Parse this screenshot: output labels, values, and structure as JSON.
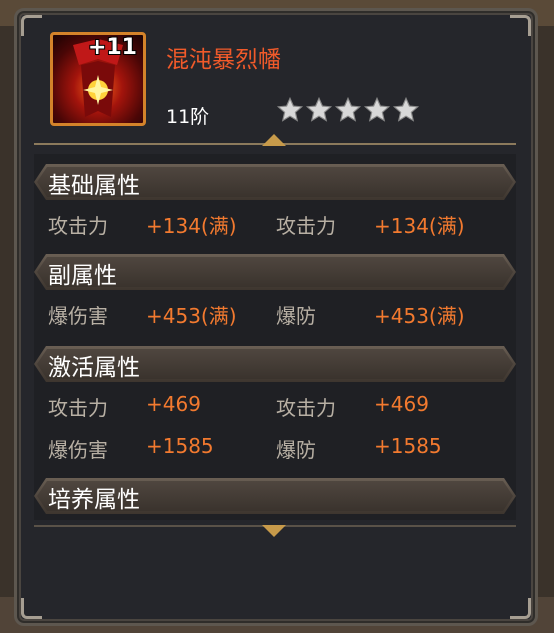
{
  "item": {
    "name": "混沌暴烈幡",
    "level": "+11",
    "tier": "11阶",
    "stars": 5,
    "icon": "banner-item-icon",
    "name_color": "#f15a2a",
    "frame_color": "#d4832a"
  },
  "sections": {
    "basic": {
      "title": "基础属性",
      "rows": [
        {
          "l1": "攻击力",
          "v1": "+134(满)",
          "l2": "攻击力",
          "v2": "+134(满)"
        }
      ]
    },
    "sub": {
      "title": "副属性",
      "rows": [
        {
          "l1": "爆伤害",
          "v1": "+453(满)",
          "l2": "爆防",
          "v2": "+453(满)"
        }
      ]
    },
    "activate": {
      "title": "激活属性",
      "rows": [
        {
          "l1": "攻击力",
          "v1": "+469",
          "l2": "攻击力",
          "v2": "+469"
        },
        {
          "l1": "爆伤害",
          "v1": "+1585",
          "l2": "爆防",
          "v2": "+1585"
        }
      ]
    },
    "cultivate": {
      "title": "培养属性"
    }
  },
  "colors": {
    "value": "#f37a2f",
    "label": "#b8b0a4",
    "panel": "#25262b"
  }
}
